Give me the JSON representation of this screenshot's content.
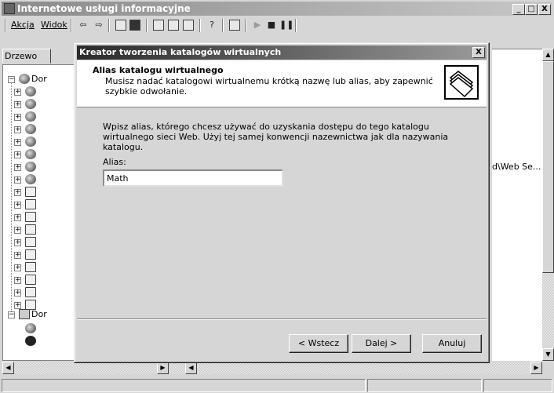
{
  "app": {
    "title": "Internetowe usługi informacyjne",
    "window_buttons": {
      "minimize": "_",
      "maximize": "□",
      "close": "X"
    }
  },
  "menu": {
    "items": [
      {
        "label": "Akcja"
      },
      {
        "label": "Widok"
      }
    ]
  },
  "toolbar": {
    "icons": [
      "back-icon",
      "forward-icon",
      "up-icon",
      "show-hide-tree-icon",
      "export-icon",
      "properties-icon",
      "refresh-icon",
      "help-icon",
      "computer-icon",
      "play-icon",
      "stop-icon",
      "pause-icon"
    ]
  },
  "left_pane": {
    "tab_label": "Drzewo",
    "tree_root_label": "Dor",
    "tree_second_root_label": "Dor"
  },
  "right_pane": {
    "path_text": "d\\Web Se..."
  },
  "dialog": {
    "title": "Kreator tworzenia katalogów wirtualnych",
    "close_label": "X",
    "header_title": "Alias katalogu wirtualnego",
    "header_subtitle": "Musisz nadać katalogowi wirtualnemu krótką nazwę lub alias, aby zapewnić szybkie odwołanie.",
    "body_text": "Wpisz alias, którego chcesz używać do uzyskania dostępu do tego katalogu wirtualnego sieci Web. Użyj tej samej konwencji nazewnictwa jak dla nazywania katalogu.",
    "alias_label": "Alias:",
    "alias_value": "Math",
    "buttons": {
      "back": "< Wstecz",
      "next": "Dalej >",
      "cancel": "Anuluj"
    }
  }
}
